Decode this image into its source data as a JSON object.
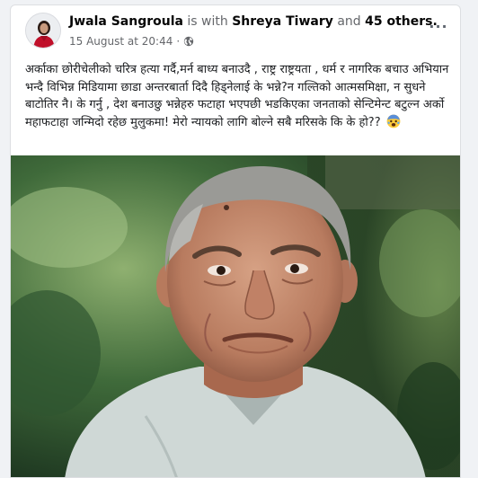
{
  "post": {
    "author": "Jwala Sangroula",
    "with_word": "is with",
    "tagged_person": "Shreya Tiwary",
    "and_word": "and",
    "others": "45 others.",
    "timestamp": "15 August at 20:44",
    "separator": "·",
    "audience_icon": "globe-icon",
    "more_label": "···",
    "text": "अर्काका छोरीचेलीको चरित्र हत्या गर्दै,मर्न बाध्य बनाउदै , राष्ट्र राष्ट्रयता , धर्म र नागरिक बचाउ अभियान भन्दै विभिन्न मिडियामा छाडा अन्तरबार्ता दिदै हिड्नेलाई के भन्ने?न गल्तिको आत्मसमिक्षा, न सुधने बाटोतिर नै। के गर्नु , देश बनाउछु भन्नेहरु फटाहा भएपछी भडकिएका जनताको सेन्टिमेन्ट बटुल्न अर्को महाफटाहा जन्मिदो रहेछ मुलुकमा! मेरो न्यायको लागि बोल्ने सबै मरिसके कि के हो??",
    "emoji": "fearful-face-emoji",
    "photo_icon": "portrait-photo"
  },
  "colors": {
    "name": "#050505",
    "secondary": "#65676b",
    "body_text": "#1c1e21",
    "card_bg": "#ffffff",
    "page_bg": "#f0f2f5"
  }
}
